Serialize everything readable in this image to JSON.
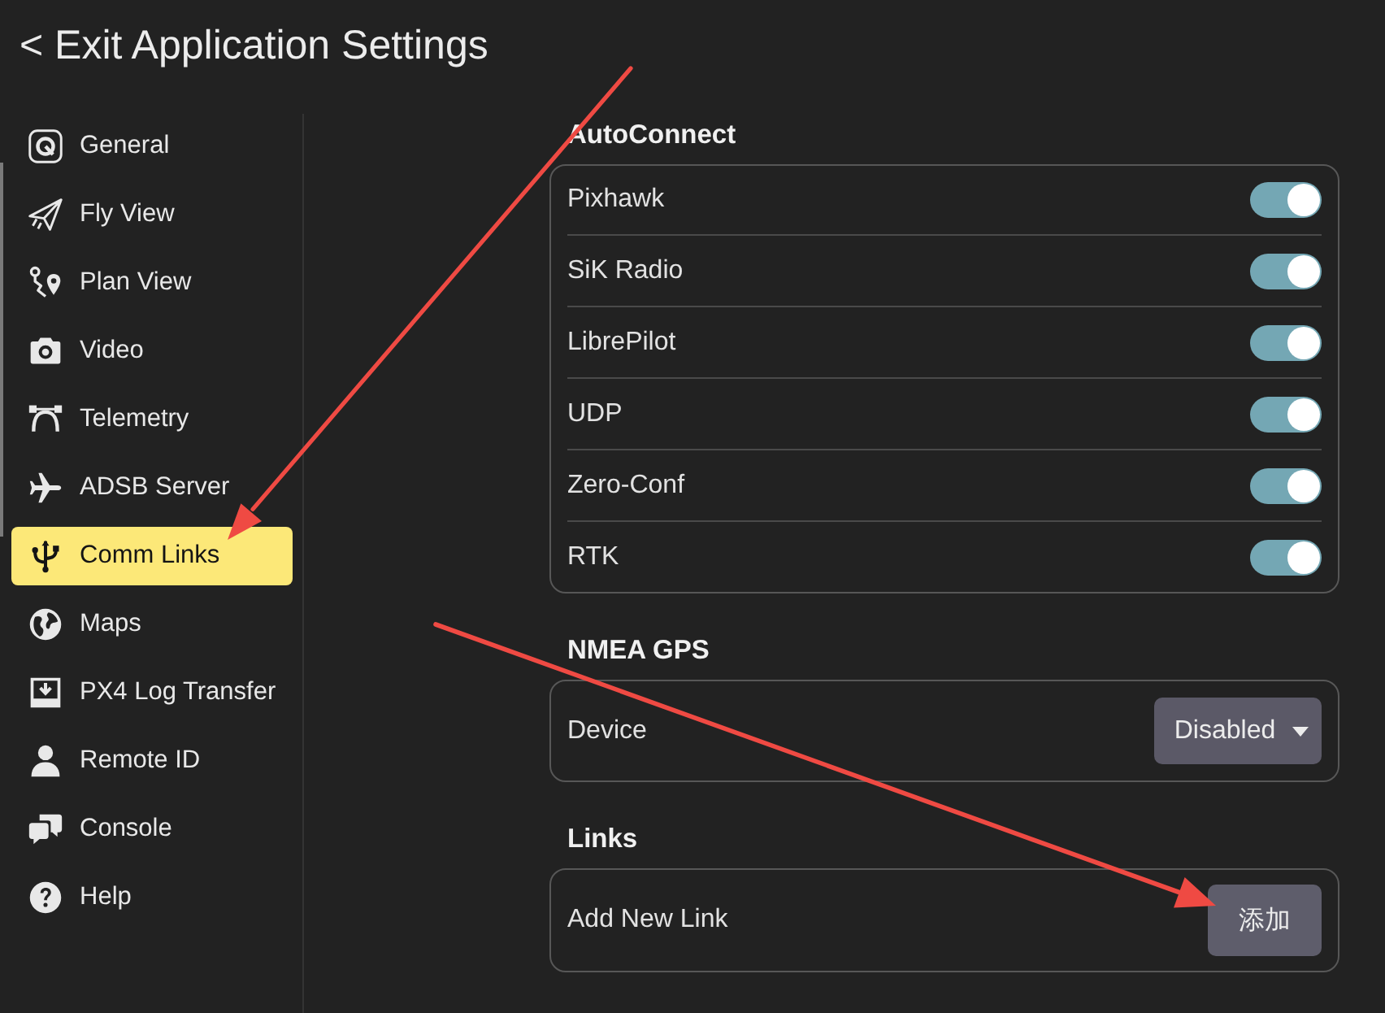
{
  "header": {
    "back_button": "< Exit Application Settings"
  },
  "sidebar": {
    "items": [
      {
        "label": "General",
        "selected": false
      },
      {
        "label": "Fly View",
        "selected": false
      },
      {
        "label": "Plan View",
        "selected": false
      },
      {
        "label": "Video",
        "selected": false
      },
      {
        "label": "Telemetry",
        "selected": false
      },
      {
        "label": "ADSB Server",
        "selected": false
      },
      {
        "label": "Comm Links",
        "selected": true
      },
      {
        "label": "Maps",
        "selected": false
      },
      {
        "label": "PX4 Log Transfer",
        "selected": false
      },
      {
        "label": "Remote ID",
        "selected": false
      },
      {
        "label": "Console",
        "selected": false
      },
      {
        "label": "Help",
        "selected": false
      }
    ]
  },
  "sections": [
    {
      "title": "AutoConnect",
      "rows": [
        {
          "kind": "toggle",
          "label": "Pixhawk",
          "on": true
        },
        {
          "kind": "toggle",
          "label": "SiK Radio",
          "on": true
        },
        {
          "kind": "toggle",
          "label": "LibrePilot",
          "on": true
        },
        {
          "kind": "toggle",
          "label": "UDP",
          "on": true
        },
        {
          "kind": "toggle",
          "label": "Zero-Conf",
          "on": true
        },
        {
          "kind": "toggle",
          "label": "RTK",
          "on": true
        }
      ]
    },
    {
      "title": "NMEA GPS",
      "rows": [
        {
          "kind": "dropdown",
          "label": "Device",
          "value": "Disabled"
        }
      ]
    },
    {
      "title": "Links",
      "rows": [
        {
          "kind": "button",
          "label": "Add New Link",
          "button": "添加"
        }
      ]
    }
  ]
}
